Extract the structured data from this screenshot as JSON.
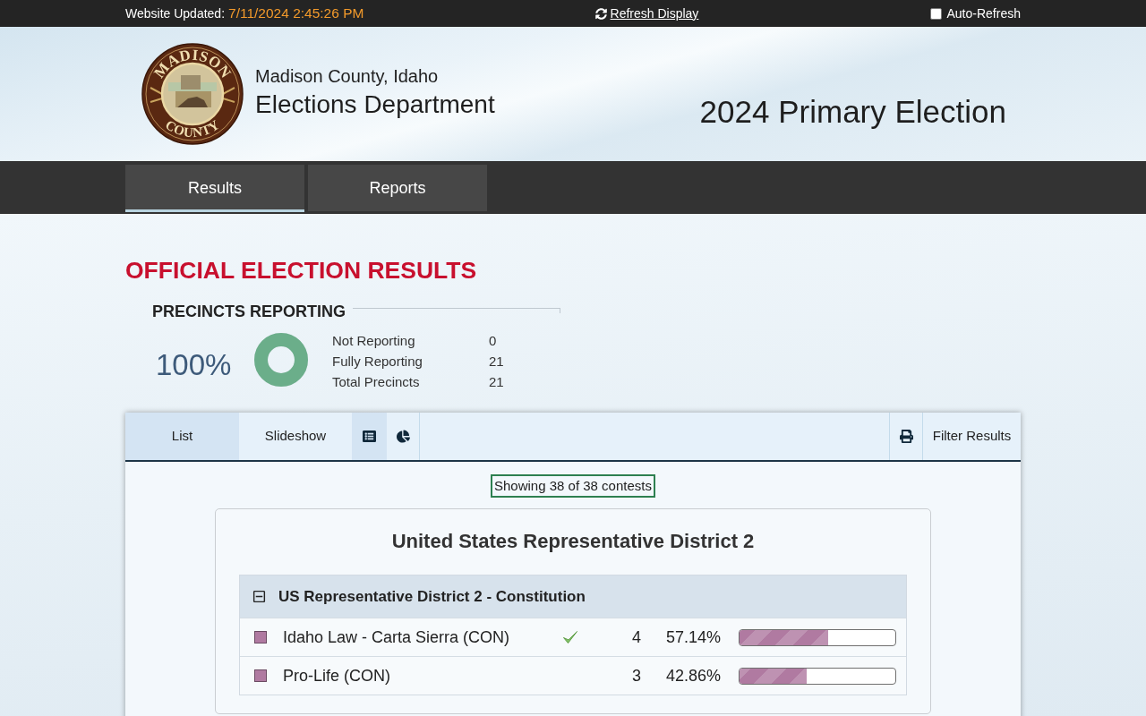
{
  "top_bar": {
    "updated_label": "Website Updated:",
    "updated_time": "7/11/2024 2:45:26 PM",
    "refresh_link": "Refresh Display",
    "auto_refresh": {
      "label": "Auto-Refresh",
      "checked": false
    }
  },
  "header": {
    "logo": {
      "top_text": "MADISON",
      "bottom_text": "COUNTY"
    },
    "county": "Madison County, Idaho",
    "department": "Elections Department",
    "election": "2024 Primary Election"
  },
  "nav_tabs": [
    {
      "label": "Results",
      "selected": true
    },
    {
      "label": "Reports",
      "selected": false
    }
  ],
  "page_title": "OFFICIAL ELECTION RESULTS",
  "precincts": {
    "title": "PRECINCTS REPORTING",
    "percent": "100%",
    "level": 1,
    "rows": [
      {
        "label": "Not Reporting",
        "value": "0"
      },
      {
        "label": "Fully Reporting",
        "value": "21"
      },
      {
        "label": "Total Precincts",
        "value": "21"
      }
    ]
  },
  "toolbar": {
    "view_tabs": [
      {
        "kind": "text",
        "label": "List",
        "selected": true
      },
      {
        "kind": "text",
        "label": "Slideshow",
        "selected": false
      },
      {
        "kind": "list_icon",
        "selected": true
      },
      {
        "kind": "pie_icon",
        "selected": false
      }
    ],
    "right_buttons": [
      {
        "kind": "print_icon"
      },
      {
        "kind": "text",
        "label": "Filter Results"
      }
    ]
  },
  "summary": "Showing 38 of 38 contests",
  "contests": [
    {
      "title": "United States Representative District 2",
      "races": [
        {
          "title": "US Representative District 2 - Constitution",
          "expanded": true,
          "candidates": [
            {
              "name": "Idaho Law - Carta Sierra (CON)",
              "color": "#b07aa1",
              "winner": true,
              "votes": "4",
              "percent": "57.14%",
              "level": 0.5714
            },
            {
              "name": "Pro-Life (CON)",
              "color": "#b07aa1",
              "winner": false,
              "votes": "3",
              "percent": "42.86%",
              "level": 0.4286
            }
          ]
        }
      ]
    }
  ]
}
